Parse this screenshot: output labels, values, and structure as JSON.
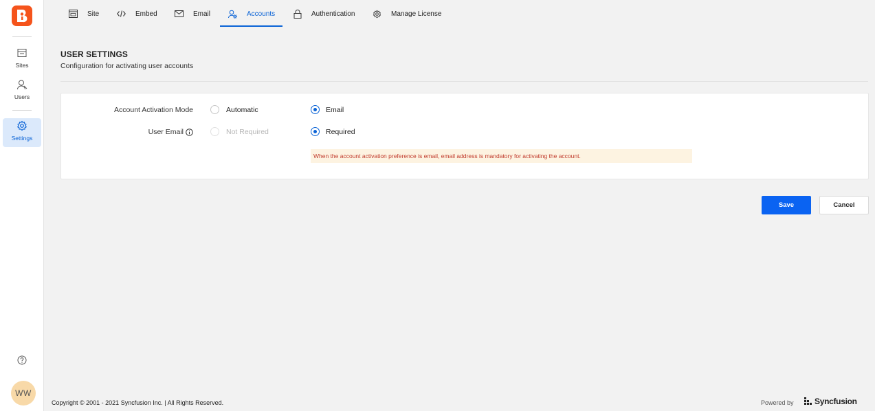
{
  "sidebar": {
    "items": [
      {
        "label": "Sites",
        "icon": "sites-icon"
      },
      {
        "label": "Users",
        "icon": "users-icon"
      },
      {
        "label": "Settings",
        "icon": "gear-icon",
        "active": true
      }
    ],
    "avatar": "WW"
  },
  "tabs": [
    {
      "label": "Site",
      "icon": "site-icon"
    },
    {
      "label": "Embed",
      "icon": "code-icon"
    },
    {
      "label": "Email",
      "icon": "mail-icon"
    },
    {
      "label": "Accounts",
      "icon": "accounts-icon",
      "active": true
    },
    {
      "label": "Authentication",
      "icon": "lock-icon"
    },
    {
      "label": "Manage License",
      "icon": "gear-icon"
    }
  ],
  "header": {
    "title": "USER SETTINGS",
    "subtitle": "Configuration for activating user accounts"
  },
  "form": {
    "activation_mode": {
      "label": "Account Activation Mode",
      "options": [
        "Automatic",
        "Email"
      ],
      "selected": "Email"
    },
    "user_email": {
      "label": "User Email",
      "options": [
        "Not Required",
        "Required"
      ],
      "selected": "Required"
    },
    "notice": "When the account activation preference is email, email address is mandatory for activating the account."
  },
  "actions": {
    "save_label": "Save",
    "cancel_label": "Cancel"
  },
  "footer": {
    "copyright": "Copyright © 2001 - 2021 Syncfusion Inc. | All Rights Reserved.",
    "powered_by": "Powered by",
    "brand": "Syncfusion"
  },
  "colors": {
    "accent": "#0a63d6",
    "logo": "#f5541c",
    "notice_text": "#c0392b",
    "notice_bg": "#fdf3e1"
  }
}
